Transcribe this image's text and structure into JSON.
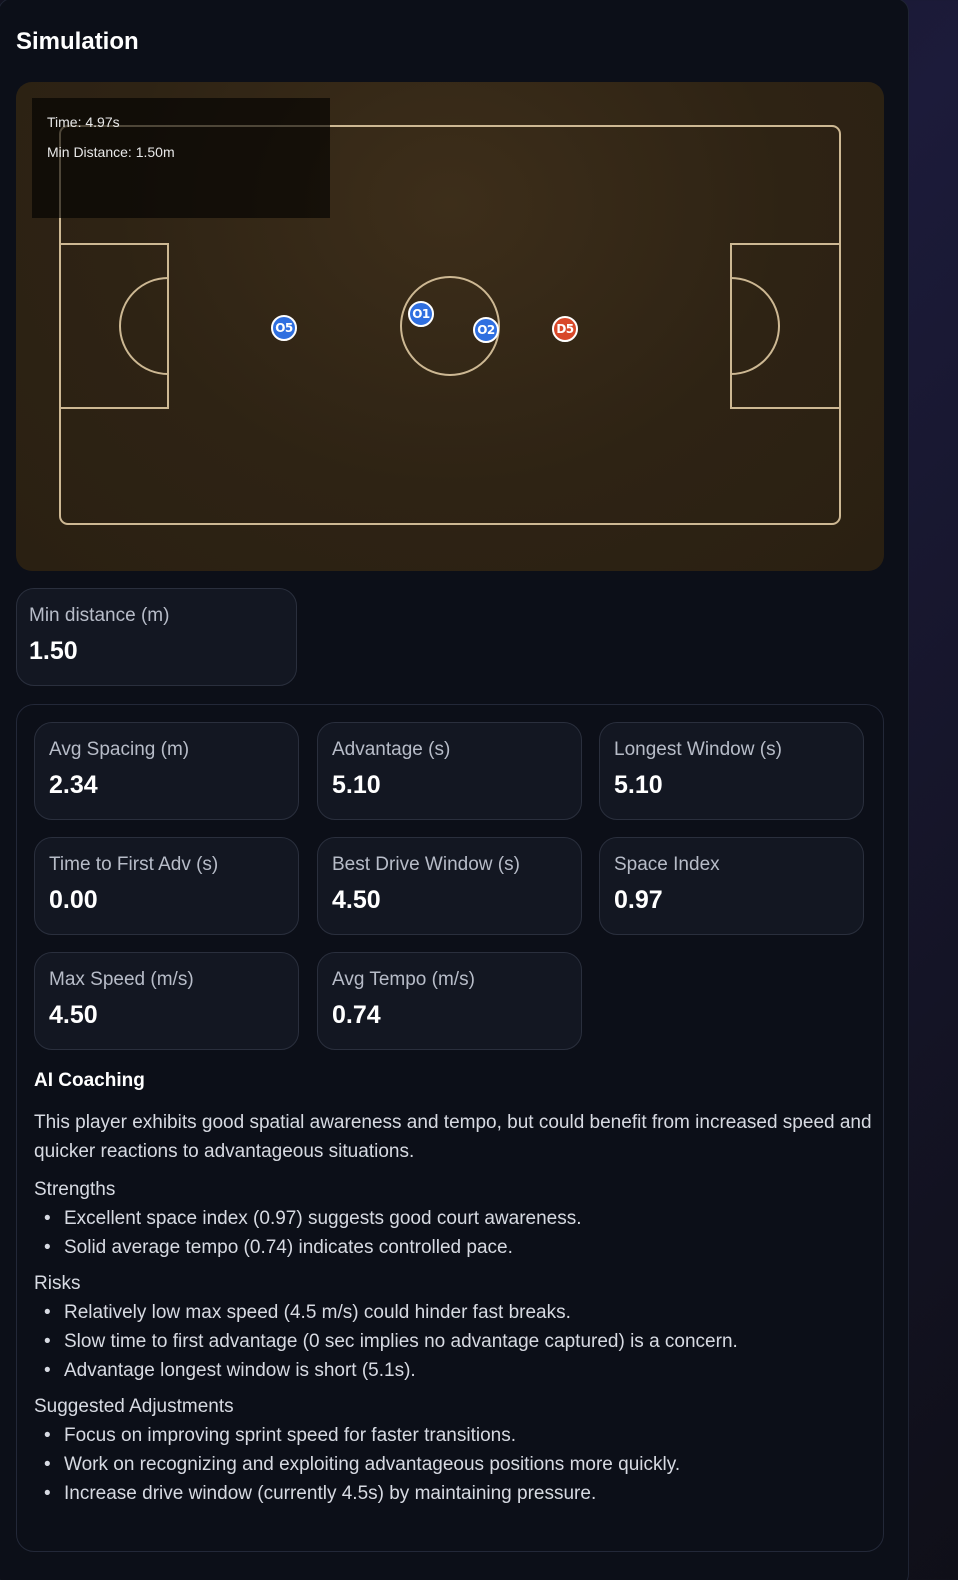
{
  "title": "Simulation",
  "hud": {
    "time": "Time: 4.97s",
    "min_distance": "Min Distance: 1.50m"
  },
  "players": [
    {
      "id": "O5",
      "team": "offense",
      "color": "#2f6fe0"
    },
    {
      "id": "O1",
      "team": "offense",
      "color": "#2f6fe0"
    },
    {
      "id": "O2",
      "team": "offense",
      "color": "#2f6fe0"
    },
    {
      "id": "D5",
      "team": "defense",
      "color": "#d8482a"
    }
  ],
  "min_distance_card": {
    "label": "Min distance (m)",
    "value": "1.50"
  },
  "stats": [
    {
      "label": "Avg Spacing (m)",
      "value": "2.34"
    },
    {
      "label": "Advantage (s)",
      "value": "5.10"
    },
    {
      "label": "Longest Window (s)",
      "value": "5.10"
    },
    {
      "label": "Time to First Adv (s)",
      "value": "0.00"
    },
    {
      "label": "Best Drive Window (s)",
      "value": "4.50"
    },
    {
      "label": "Space Index",
      "value": "0.97"
    },
    {
      "label": "Max Speed (m/s)",
      "value": "4.50"
    },
    {
      "label": "Avg Tempo (m/s)",
      "value": "0.74"
    }
  ],
  "coaching": {
    "heading": "AI Coaching",
    "summary": "This player exhibits good spatial awareness and tempo, but could benefit from increased speed and quicker reactions to advantageous situations.",
    "strengths_heading": "Strengths",
    "strengths": [
      "Excellent space index (0.97) suggests good court awareness.",
      "Solid average tempo (0.74) indicates controlled pace."
    ],
    "risks_heading": "Risks",
    "risks": [
      "Relatively low max speed (4.5 m/s) could hinder fast breaks.",
      "Slow time to first advantage (0 sec implies no advantage captured) is a concern.",
      "Advantage longest window is short (5.1s)."
    ],
    "adjust_heading": "Suggested Adjustments",
    "adjustments": [
      "Focus on improving sprint speed for faster transitions.",
      "Work on recognizing and exploiting advantageous positions more quickly.",
      "Increase drive window (currently 4.5s) by maintaining pressure."
    ]
  },
  "colors": {
    "field_line": "#cdb893",
    "offense": "#2f6fe0",
    "defense": "#d8482a"
  }
}
